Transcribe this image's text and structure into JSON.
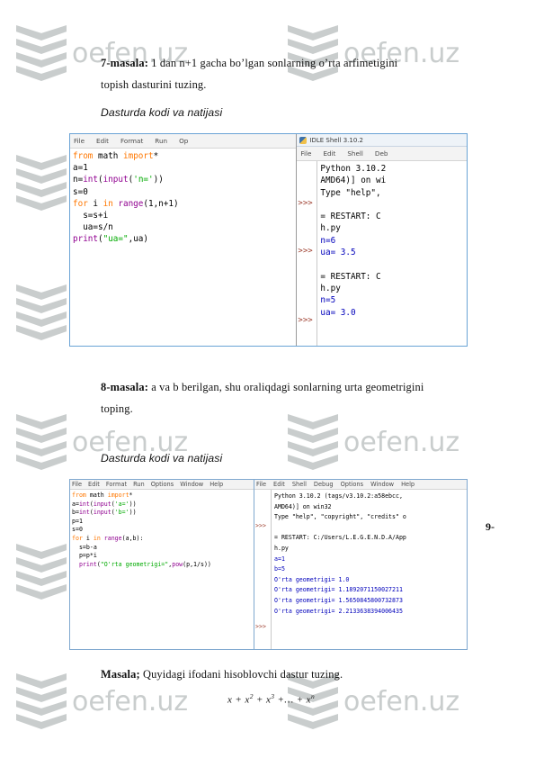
{
  "document": {
    "page_number": "9-",
    "watermark_text": "oefen.uz"
  },
  "sections": [
    {
      "id": "task7",
      "label": "7-masala:",
      "text": " 1 dan n+1 gacha bo’lgan sonlarning o’rta arfimetigini topish dasturini tuzing.",
      "subtitle": "Dasturda kodi va natijasi"
    },
    {
      "id": "task8",
      "label": "8-masala:",
      "text": " a va b berilgan, shu oraliqdagi sonlarning urta geometrigini toping.",
      "subtitle": "Dasturda kodi va natijasi"
    },
    {
      "id": "task9",
      "label": "Masala;",
      "text": " Quyidagi ifodani hisoblovchi dastur tuzing.",
      "formula_parts": [
        "x + x",
        "2",
        " + x",
        "3",
        " +… + x",
        "n"
      ]
    }
  ],
  "figure1": {
    "editor": {
      "title": "",
      "menu": [
        "File",
        "Edit",
        "Format",
        "Run",
        "Op"
      ],
      "code_lines": [
        [
          {
            "t": "from ",
            "c": "kw"
          },
          {
            "t": "math ",
            "c": "blk"
          },
          {
            "t": "import",
            "c": "kw"
          },
          {
            "t": "*",
            "c": "blk"
          }
        ],
        [
          {
            "t": "a=",
            "c": "blk"
          },
          {
            "t": "1",
            "c": "blk"
          }
        ],
        [
          {
            "t": "n=",
            "c": "blk"
          },
          {
            "t": "int",
            "c": "bi"
          },
          {
            "t": "(",
            "c": "blk"
          },
          {
            "t": "input",
            "c": "bi"
          },
          {
            "t": "(",
            "c": "blk"
          },
          {
            "t": "'n='",
            "c": "str"
          },
          {
            "t": "))",
            "c": "blk"
          }
        ],
        [
          {
            "t": "s=0",
            "c": "blk"
          }
        ],
        [
          {
            "t": "for ",
            "c": "kw"
          },
          {
            "t": "i ",
            "c": "blk"
          },
          {
            "t": "in ",
            "c": "kw"
          },
          {
            "t": "range",
            "c": "bi"
          },
          {
            "t": "(1,n+1)",
            "c": "blk"
          }
        ],
        [
          {
            "t": "  s=s+i",
            "c": "blk"
          }
        ],
        [
          {
            "t": "  ua=s/n",
            "c": "blk"
          }
        ],
        [
          {
            "t": "print",
            "c": "bi"
          },
          {
            "t": "(",
            "c": "blk"
          },
          {
            "t": "\"ua=\"",
            "c": "str"
          },
          {
            "t": ",ua)",
            "c": "blk"
          }
        ]
      ]
    },
    "shell": {
      "title": "IDLE Shell 3.10.2",
      "menu": [
        "File",
        "Edit",
        "Shell",
        "Deb"
      ],
      "prompts": [
        ">>>",
        ">>>",
        ">>>"
      ],
      "lines": [
        {
          "t": "Python 3.10.2",
          "c": "blk"
        },
        {
          "t": "AMD64)] on wi",
          "c": "blk"
        },
        {
          "t": "Type \"help\",",
          "c": "blk"
        },
        {
          "t": "",
          "c": "blk"
        },
        {
          "t": "= RESTART: C",
          "c": "blk"
        },
        {
          "t": "h.py",
          "c": "blk"
        },
        {
          "t": "n=6",
          "c": "out"
        },
        {
          "t": "ua= 3.5",
          "c": "out"
        },
        {
          "t": "",
          "c": "blk"
        },
        {
          "t": "= RESTART: C",
          "c": "blk"
        },
        {
          "t": "h.py",
          "c": "blk"
        },
        {
          "t": "n=5",
          "c": "out"
        },
        {
          "t": "ua= 3.0",
          "c": "out"
        }
      ]
    }
  },
  "figure2": {
    "editor": {
      "menu": [
        "File",
        "Edit",
        "Format",
        "Run",
        "Options",
        "Window",
        "Help"
      ],
      "code_lines": [
        [
          {
            "t": "from ",
            "c": "kw"
          },
          {
            "t": "math ",
            "c": "blk"
          },
          {
            "t": "import",
            "c": "kw"
          },
          {
            "t": "*",
            "c": "blk"
          }
        ],
        [
          {
            "t": "a=",
            "c": "blk"
          },
          {
            "t": "int",
            "c": "bi"
          },
          {
            "t": "(",
            "c": "blk"
          },
          {
            "t": "input",
            "c": "bi"
          },
          {
            "t": "(",
            "c": "blk"
          },
          {
            "t": "'a='",
            "c": "str"
          },
          {
            "t": "))",
            "c": "blk"
          }
        ],
        [
          {
            "t": "b=",
            "c": "blk"
          },
          {
            "t": "int",
            "c": "bi"
          },
          {
            "t": "(",
            "c": "blk"
          },
          {
            "t": "input",
            "c": "bi"
          },
          {
            "t": "(",
            "c": "blk"
          },
          {
            "t": "'b='",
            "c": "str"
          },
          {
            "t": "))",
            "c": "blk"
          }
        ],
        [
          {
            "t": "p=1",
            "c": "blk"
          }
        ],
        [
          {
            "t": "s=0",
            "c": "blk"
          }
        ],
        [
          {
            "t": "for ",
            "c": "kw"
          },
          {
            "t": "i ",
            "c": "blk"
          },
          {
            "t": "in ",
            "c": "kw"
          },
          {
            "t": "range",
            "c": "bi"
          },
          {
            "t": "(a,b):",
            "c": "blk"
          }
        ],
        [
          {
            "t": "  s=b-a",
            "c": "blk"
          }
        ],
        [
          {
            "t": "  p=p*i",
            "c": "blk"
          }
        ],
        [
          {
            "t": "  ",
            "c": "blk"
          },
          {
            "t": "print",
            "c": "bi"
          },
          {
            "t": "(",
            "c": "blk"
          },
          {
            "t": "\"O'rta geometrigi=\"",
            "c": "str"
          },
          {
            "t": ",",
            "c": "blk"
          },
          {
            "t": "pow",
            "c": "bi"
          },
          {
            "t": "(p,1/s))",
            "c": "blk"
          }
        ]
      ]
    },
    "shell": {
      "menu": [
        "File",
        "Edit",
        "Shell",
        "Debug",
        "Options",
        "Window",
        "Help"
      ],
      "prompts": [
        ">>>",
        ">>>"
      ],
      "lines": [
        {
          "t": "Python 3.10.2 (tags/v3.10.2:a58ebcc,",
          "c": "blk"
        },
        {
          "t": "AMD64)] on win32",
          "c": "blk"
        },
        {
          "t": "Type \"help\", \"copyright\", \"credits\" o",
          "c": "blk"
        },
        {
          "t": "",
          "c": "blk"
        },
        {
          "t": "= RESTART: C:/Users/L.E.G.E.N.D.A/App",
          "c": "blk"
        },
        {
          "t": "h.py",
          "c": "blk"
        },
        {
          "t": "a=1",
          "c": "out"
        },
        {
          "t": "b=5",
          "c": "out"
        },
        {
          "t": "O'rta geometrigi= 1.0",
          "c": "out"
        },
        {
          "t": "O'rta geometrigi= 1.1892071150027211",
          "c": "out"
        },
        {
          "t": "O'rta geometrigi= 1.5650845800732873",
          "c": "out"
        },
        {
          "t": "O'rta geometrigi= 2.2133638394006435",
          "c": "out"
        }
      ]
    }
  }
}
